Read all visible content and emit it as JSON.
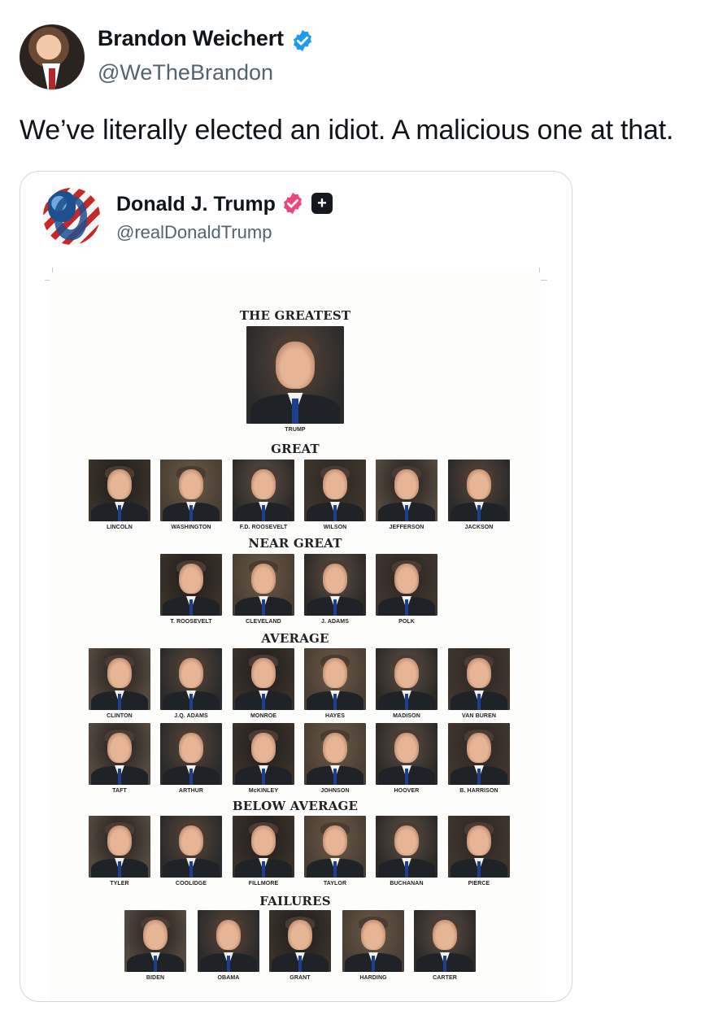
{
  "tweet": {
    "author_name": "Brandon Weichert",
    "author_handle": "@WeTheBrandon",
    "text": "We’ve literally elected an idiot. A malicious one at that.",
    "verified_color": "#1d9bf0"
  },
  "quoted_post": {
    "author_name": "Donald J. Trump",
    "author_handle": "@realDonaldTrump",
    "verified_color": "#f0447a",
    "plus_badge": "+",
    "image": {
      "tiers": [
        {
          "title": "THE GREATEST",
          "names": [
            "TRUMP"
          ]
        },
        {
          "title": "GREAT",
          "names": [
            "LINCOLN",
            "WASHINGTON",
            "F.D. ROOSEVELT",
            "WILSON",
            "JEFFERSON",
            "JACKSON"
          ]
        },
        {
          "title": "NEAR GREAT",
          "names": [
            "T. ROOSEVELT",
            "CLEVELAND",
            "J. ADAMS",
            "POLK"
          ]
        },
        {
          "title": "AVERAGE",
          "names": [
            "CLINTON",
            "J.Q. ADAMS",
            "MONROE",
            "HAYES",
            "MADISON",
            "VAN BUREN",
            "TAFT",
            "ARTHUR",
            "McKINLEY",
            "JOHNSON",
            "HOOVER",
            "B. HARRISON"
          ]
        },
        {
          "title": "BELOW AVERAGE",
          "names": [
            "TYLER",
            "COOLIDGE",
            "FILLMORE",
            "TAYLOR",
            "BUCHANAN",
            "PIERCE"
          ]
        },
        {
          "title": "FAILURES",
          "names": [
            "BIDEN",
            "OBAMA",
            "GRANT",
            "HARDING",
            "CARTER"
          ]
        }
      ]
    }
  }
}
